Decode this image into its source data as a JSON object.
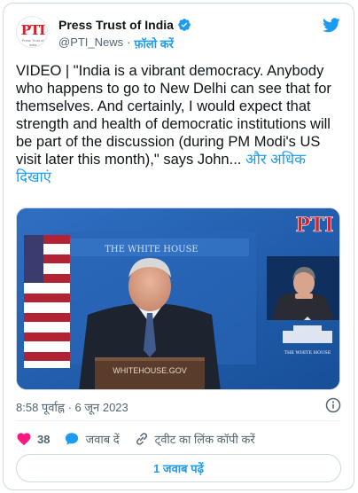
{
  "account": {
    "display_name": "Press Trust of India",
    "handle": "@PTI_News",
    "separator": "·",
    "follow_label": "फ़ॉलो करें",
    "avatar_logo_text": "PTI",
    "avatar_logo_sub": "Press Trust of India"
  },
  "tweet": {
    "text": "VIDEO | \"India is a vibrant democracy. Anybody who happens to go to New Delhi can see that for themselves. And certainly, I would expect that strength and health of democratic institutions will be part of the discussion (during PM Modi's US visit later this month),\" says John...",
    "more_label": "और अधिक दिखाएं",
    "timestamp": "8:58 पूर्वाह्न · 6 जून 2023"
  },
  "media": {
    "watermark": "PTI",
    "seal_text": "THE WHITE HOUSE",
    "podium_text": "WHITEHOUSE.GOV",
    "side_logo_text": "THE WHITE HOUSE"
  },
  "actions": {
    "like_count": "38",
    "reply_label": "जवाब दें",
    "copy_link_label": "ट्वीट का लिंक कॉपी करें"
  },
  "replies_button_label": "1 जवाब पढ़ें",
  "colors": {
    "accent": "#1d9bf0",
    "like": "#f91880",
    "pti_red": "#d4202a"
  }
}
